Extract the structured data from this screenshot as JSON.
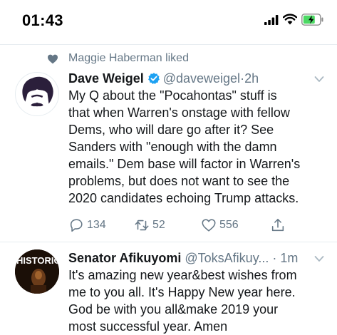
{
  "status_bar": {
    "time": "01:43"
  },
  "tweets": [
    {
      "social_context": "Maggie Haberman liked",
      "author_name": "Dave Weigel",
      "handle": "@daveweigel",
      "separator": "·",
      "time_ago": "2h",
      "verified": true,
      "text_lines": [
        "My Q about the \"Pocahontas\" stuff is",
        "that when Warren's onstage with fellow",
        "Dems, who will dare go after it? See",
        "Sanders with \"enough with the damn",
        "emails.\" Dem base will factor in Warren's",
        "problems, but does not want to see the",
        "2020 candidates echoing Trump attacks."
      ],
      "reply_count": "134",
      "retweet_count": "52",
      "like_count": "556"
    },
    {
      "author_name": "Senator Afikuyomi",
      "handle": "@ToksAfikuy...",
      "separator": "·",
      "time_ago": "1m",
      "avatar_text": "HISTORIC",
      "text_lines": [
        "It's amazing new year&best wishes from",
        "me to you all. It's Happy New year here.",
        "God be with you all&make 2019 your",
        "most successful year. Amen"
      ]
    }
  ],
  "colors": {
    "verified": "#1da1f2",
    "secondary_text": "#657786",
    "divider": "#e6ecf0"
  }
}
